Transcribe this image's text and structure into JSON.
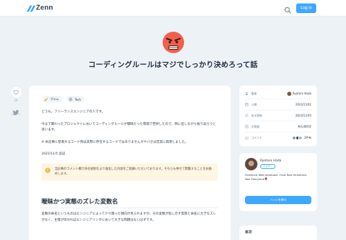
{
  "header": {
    "logo_text": "Zenn",
    "login_label": "Log in"
  },
  "hero": {
    "emoji": "angry-face",
    "title": "コーディングルールはマジでしっかり決めろって話"
  },
  "rail": {
    "like_count": "26",
    "share_label": "ツイート"
  },
  "article": {
    "topics": [
      {
        "label": "ポエム",
        "icon": "pencil-icon"
      },
      {
        "label": "Tech",
        "icon": "gear-icon"
      }
    ],
    "intro": "どうも。フリーランスエンジニアの人です。",
    "p1": "今まで関わったプロジェクトにおいてコーディングルールが曖昧だった環境で苦労したので、例に出しながら振り返ろうと思います。",
    "p2": "※ 本記事に登場するコード例は実際に存在するコードではありませんがヤバさは忠実に再現しました。",
    "date_note": "2022/11/5 追記",
    "notice": "当記事のコメント欄で命名規則をより強化した内容をご指摘いただいております。そちらも併せて閲覧することをお勧めします。",
    "h2": "曖昧かつ実態のズレた変数名",
    "p3": "変数の命名というものはエンジニアによって少々雑った傾向が見られますが、その変数が指し示す実態と命名に大きなズレがなく、主張が伝わればエンジニアリングにおいて大きな問題はないはずです。"
  },
  "info": {
    "author_key": "著者",
    "author_val": "Ryotaro Hada",
    "published_key": "公開",
    "published_val": "2022/11/01",
    "updated_key": "本文更新",
    "updated_val": "2022/11/05",
    "read_key": "文章量",
    "read_val": "約3,800字",
    "comment_key": "コメント",
    "comment_val": "2件有"
  },
  "author": {
    "name": "Ryotaro Hada",
    "follow_label": "フォロー",
    "bio": "Freelance Web developer. From Neo Hiroshima. Neo Fukuyama🌹",
    "support_label": "バッジを贈る"
  },
  "toc": {
    "title": "目次"
  },
  "colors": {
    "accent": "#3ea8ff",
    "background": "#edf2f7"
  }
}
